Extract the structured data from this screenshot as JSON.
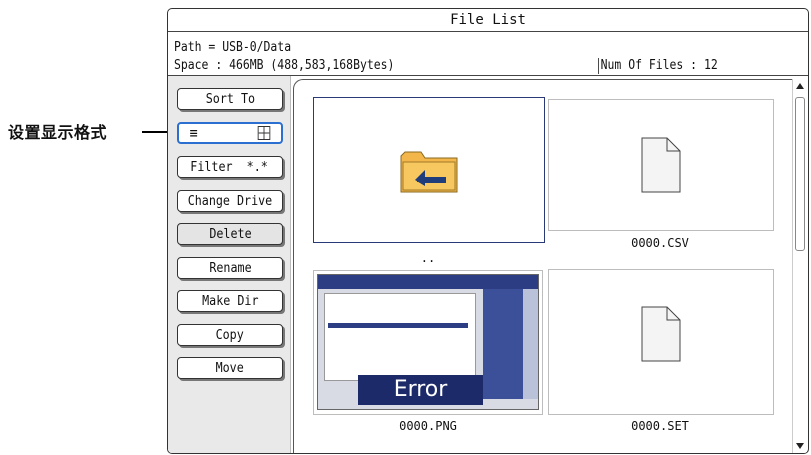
{
  "callout": {
    "label": "设置显示格式"
  },
  "window": {
    "title": "File List"
  },
  "info": {
    "path": "Path = USB-0/Data",
    "space": "Space : 466MB (488,583,168Bytes)",
    "num_files": "Num Of Files : 12"
  },
  "buttons": {
    "sort_to": "Sort To",
    "view_list_icon": "≡",
    "view_thumb_icon": "⊞",
    "filter": "Filter  *.*",
    "change_drive": "Change Drive",
    "delete": "Delete",
    "rename": "Rename",
    "make_dir": "Make Dir",
    "copy": "Copy",
    "move": "Move"
  },
  "files": [
    {
      "name": "..",
      "icon": "folder-up-icon"
    },
    {
      "name": "0000.CSV",
      "icon": "file-icon"
    },
    {
      "name": "0000.PNG",
      "icon": "image-thumbnail"
    },
    {
      "name": "0000.SET",
      "icon": "file-icon"
    }
  ],
  "thumbnail": {
    "text": "Error"
  },
  "colors": {
    "accent": "#2b6fd1",
    "folder": "#f3b64a",
    "folder_arrow": "#1f3d7a"
  }
}
